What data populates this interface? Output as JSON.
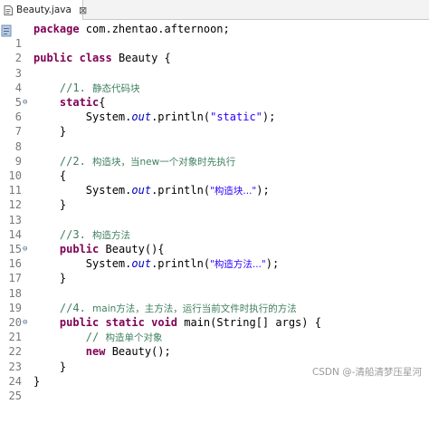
{
  "tab": {
    "label": "Beauty.java",
    "close": "⊠"
  },
  "code": {
    "l1": {
      "num": "1",
      "kw": "package",
      "rest": " com.zhentao.afternoon;"
    },
    "l2": {
      "num": "2"
    },
    "l3": {
      "num": "3",
      "kw1": "public",
      "kw2": "class",
      "rest": " Beauty {"
    },
    "l4": {
      "num": "4"
    },
    "l5": {
      "num": "5",
      "comment_prefix": "//1. ",
      "comment_cn": "静态代码块"
    },
    "l6": {
      "num": "6",
      "kw": "static",
      "rest": "{"
    },
    "l7": {
      "num": "7",
      "pre": "System.",
      "field": "out",
      "mid": ".println(",
      "str": "\"static\"",
      "post": ");"
    },
    "l8": {
      "num": "8",
      "rest": "}"
    },
    "l9": {
      "num": "9"
    },
    "l10": {
      "num": "10",
      "comment_prefix": "//2. ",
      "comment_cn": "构造块，当new一个对象时先执行"
    },
    "l11": {
      "num": "11",
      "rest": "{"
    },
    "l12": {
      "num": "12",
      "pre": "System.",
      "field": "out",
      "mid": ".println(",
      "str": "\"构造块...\"",
      "post": ");"
    },
    "l13": {
      "num": "13",
      "rest": "}"
    },
    "l14": {
      "num": "14"
    },
    "l15": {
      "num": "15",
      "comment_prefix": "//3. ",
      "comment_cn": "构造方法"
    },
    "l16": {
      "num": "16",
      "kw": "public",
      "rest": " Beauty(){"
    },
    "l17": {
      "num": "17",
      "pre": "System.",
      "field": "out",
      "mid": ".println(",
      "str": "\"构造方法...\"",
      "post": ");"
    },
    "l18": {
      "num": "18",
      "rest": "}"
    },
    "l19": {
      "num": "19"
    },
    "l20": {
      "num": "20",
      "comment_prefix": "//4. ",
      "comment_cn": "main方法，主方法，运行当前文件时执行的方法"
    },
    "l21": {
      "num": "21",
      "kw1": "public",
      "kw2": "static",
      "kw3": "void",
      "rest": " main(String[] args) {"
    },
    "l22": {
      "num": "22",
      "comment_prefix": "// ",
      "comment_cn": "构造单个对象"
    },
    "l23": {
      "num": "23",
      "kw": "new",
      "rest": " Beauty();"
    },
    "l24": {
      "num": "24",
      "rest": "}"
    },
    "l25": {
      "num": "25",
      "rest": "}"
    }
  },
  "fold_marker": "⊖",
  "watermark": "CSDN @-清船清梦压星河",
  "colors": {
    "keyword": "#7f0055",
    "comment": "#3f7f5f",
    "string": "#2a00ff",
    "field": "#0000c0",
    "line_number": "#787878"
  }
}
